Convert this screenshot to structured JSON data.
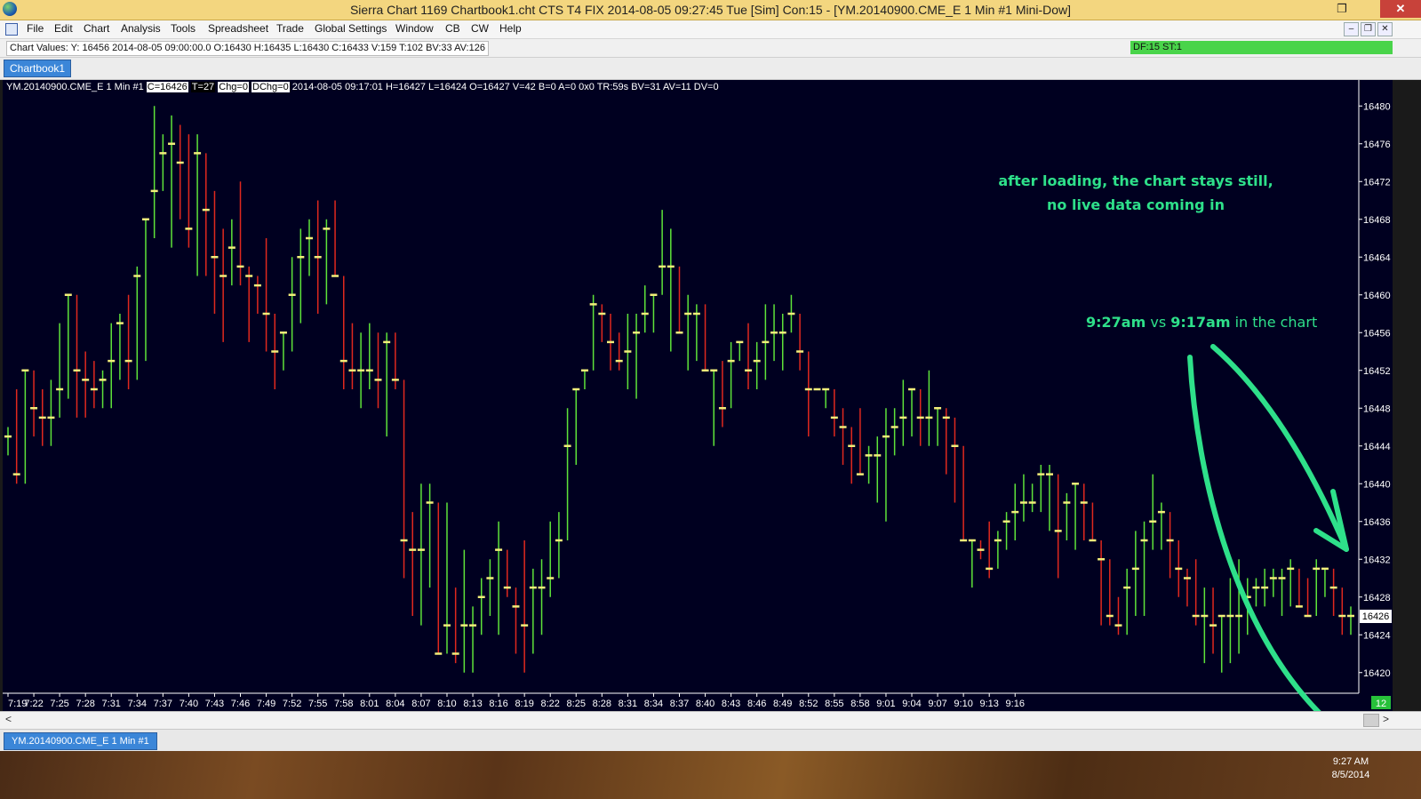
{
  "window": {
    "title": "Sierra Chart 1169 Chartbook1.cht  CTS T4 FIX 2014-08-05  09:27:45 Tue [Sim]  Con:15 - [YM.20140900.CME_E  1 Min   #1  Mini-Dow]",
    "restore_label": "❐",
    "close_label": "✕"
  },
  "menu": [
    "File",
    "Edit",
    "Chart",
    "Analysis",
    "Tools",
    "Spreadsheet",
    "Trade",
    "Global Settings",
    "Window",
    "CB",
    "CW",
    "Help"
  ],
  "mdi_buttons": [
    "–",
    "❐",
    "✕"
  ],
  "values_bar": {
    "chart_values": "Chart Values: Y: 16456  2014-08-05  09:00:00.0  O:16430  H:16435  L:16430  C:16433  V:159  T:102  BV:33  AV:126",
    "status": "DF:15  ST:1"
  },
  "chartbook_tab": "Chartbook1",
  "header": {
    "symbol": "YM.20140900.CME_E  1 Min   #1",
    "c": "C=16426",
    "t": "T=27",
    "chg": "Chg=0",
    "dchg": "DChg=0",
    "details": "2014-08-05 09:17:01 H=16427 L=16424 O=16427 V=42 B=0 A=0 0x0 TR:59s BV=31 AV=11 DV=0"
  },
  "price_axis": {
    "labels": [
      "16480",
      "16476",
      "16472",
      "16468",
      "16464",
      "16460",
      "16456",
      "16452",
      "16448",
      "16444",
      "16440",
      "16436",
      "16432",
      "16428",
      "16424",
      "16420"
    ],
    "current_price": "16426"
  },
  "time_axis": {
    "labels": [
      "7:19",
      "7:22",
      "7:25",
      "7:28",
      "7:31",
      "7:34",
      "7:37",
      "7:40",
      "7:43",
      "7:46",
      "7:49",
      "7:52",
      "7:55",
      "7:58",
      "8:01",
      "8:04",
      "8:07",
      "8:10",
      "8:13",
      "8:16",
      "8:19",
      "8:22",
      "8:25",
      "8:28",
      "8:31",
      "8:34",
      "8:37",
      "8:40",
      "8:43",
      "8:46",
      "8:49",
      "8:52",
      "8:55",
      "8:58",
      "9:01",
      "9:04",
      "9:07",
      "9:10",
      "9:13",
      "9:16"
    ],
    "corner_badge": "12"
  },
  "annotations": {
    "note1_line1": "after loading, the chart stays still,",
    "note1_line2": "no live data coming in",
    "note2_a": "9:27am",
    "note2_b": " vs ",
    "note2_c": "9:17am",
    "note2_d": " in the chart"
  },
  "bottom_tab": "YM.20140900.CME_E  1 Min   #1",
  "clock": {
    "time": "9:27 AM",
    "date": "8/5/2014"
  },
  "chart_data": {
    "type": "bar",
    "ohlc": [
      [
        16445,
        16446,
        16443,
        16445
      ],
      [
        16445,
        16450,
        16440,
        16441
      ],
      [
        16441,
        16452,
        16440,
        16452
      ],
      [
        16451,
        16452,
        16445,
        16448
      ],
      [
        16448,
        16450,
        16444,
        16447
      ],
      [
        16447,
        16451,
        16444,
        16447
      ],
      [
        16447,
        16457,
        16448,
        16450
      ],
      [
        16450,
        16460,
        16449,
        16460
      ],
      [
        16460,
        16460,
        16447,
        16452
      ],
      [
        16452,
        16454,
        16447,
        16451
      ],
      [
        16451,
        16453,
        16448,
        16450
      ],
      [
        16450,
        16452,
        16448,
        16451
      ],
      [
        16451,
        16457,
        16448,
        16453
      ],
      [
        16453,
        16458,
        16451,
        16457
      ],
      [
        16457,
        16460,
        16450,
        16453
      ],
      [
        16453,
        16463,
        16451,
        16462
      ],
      [
        16462,
        16468,
        16453,
        16468
      ],
      [
        16468,
        16480,
        16466,
        16471
      ],
      [
        16471,
        16477,
        16471,
        16475
      ],
      [
        16475,
        16479,
        16465,
        16476
      ],
      [
        16476,
        16478,
        16468,
        16474
      ],
      [
        16474,
        16477,
        16465,
        16467
      ],
      [
        16467,
        16477,
        16462,
        16475
      ],
      [
        16475,
        16475,
        16462,
        16469
      ],
      [
        16469,
        16471,
        16458,
        16464
      ],
      [
        16464,
        16467,
        16455,
        16462
      ],
      [
        16462,
        16468,
        16461,
        16465
      ],
      [
        16465,
        16472,
        16461,
        16463
      ],
      [
        16463,
        16462,
        16455,
        16462
      ],
      [
        16462,
        16462,
        16458,
        16461
      ],
      [
        16461,
        16466,
        16454,
        16458
      ],
      [
        16458,
        16456,
        16450,
        16454
      ],
      [
        16454,
        16456,
        16452,
        16456
      ],
      [
        16456,
        16464,
        16454,
        16460
      ],
      [
        16460,
        16467,
        16457,
        16464
      ],
      [
        16464,
        16468,
        16462,
        16466
      ],
      [
        16466,
        16470,
        16458,
        16464
      ],
      [
        16464,
        16468,
        16459,
        16467
      ],
      [
        16467,
        16470,
        16462,
        16462
      ],
      [
        16462,
        16458,
        16450,
        16453
      ],
      [
        16453,
        16457,
        16450,
        16452
      ],
      [
        16452,
        16456,
        16448,
        16452
      ],
      [
        16452,
        16457,
        16450,
        16452
      ],
      [
        16452,
        16456,
        16448,
        16451
      ],
      [
        16451,
        16456,
        16445,
        16455
      ],
      [
        16455,
        16456,
        16450,
        16451
      ],
      [
        16451,
        16450,
        16430,
        16434
      ],
      [
        16434,
        16437,
        16426,
        16433
      ],
      [
        16433,
        16440,
        16425,
        16433
      ],
      [
        16433,
        16440,
        16429,
        16438
      ],
      [
        16438,
        16437,
        16423,
        16422
      ],
      [
        16422,
        16438,
        16422,
        16425
      ],
      [
        16425,
        16429,
        16421,
        16422
      ],
      [
        16422,
        16433,
        16420,
        16425
      ],
      [
        16425,
        16427,
        16420,
        16425
      ],
      [
        16425,
        16430,
        16424,
        16428
      ],
      [
        16428,
        16432,
        16426,
        16430
      ],
      [
        16430,
        16436,
        16424,
        16433
      ],
      [
        16433,
        16432,
        16428,
        16429
      ],
      [
        16429,
        16428,
        16422,
        16427
      ],
      [
        16427,
        16434,
        16420,
        16425
      ],
      [
        16425,
        16431,
        16422,
        16429
      ],
      [
        16429,
        16432,
        16424,
        16429
      ],
      [
        16429,
        16436,
        16428,
        16430
      ],
      [
        16430,
        16437,
        16432,
        16434
      ],
      [
        16434,
        16448,
        16435,
        16444
      ],
      [
        16444,
        16448,
        16442,
        16450
      ],
      [
        16450,
        16452,
        16450,
        16452
      ],
      [
        16452,
        16460,
        16454,
        16459
      ],
      [
        16459,
        16459,
        16455,
        16458
      ],
      [
        16458,
        16458,
        16452,
        16455
      ],
      [
        16455,
        16456,
        16452,
        16453
      ],
      [
        16453,
        16458,
        16450,
        16454
      ],
      [
        16454,
        16458,
        16449,
        16456
      ],
      [
        16456,
        16461,
        16456,
        16458
      ],
      [
        16458,
        16460,
        16456,
        16460
      ],
      [
        16460,
        16469,
        16460,
        16463
      ],
      [
        16463,
        16467,
        16454,
        16463
      ],
      [
        16463,
        16463,
        16456,
        16456
      ],
      [
        16456,
        16460,
        16452,
        16458
      ],
      [
        16458,
        16459,
        16453,
        16458
      ],
      [
        16458,
        16459,
        16453,
        16452
      ],
      [
        16452,
        16451,
        16444,
        16452
      ],
      [
        16452,
        16453,
        16446,
        16448
      ],
      [
        16448,
        16455,
        16449,
        16453
      ],
      [
        16453,
        16455,
        16453,
        16455
      ],
      [
        16455,
        16457,
        16450,
        16452
      ],
      [
        16452,
        16455,
        16450,
        16453
      ],
      [
        16453,
        16459,
        16451,
        16455
      ],
      [
        16455,
        16459,
        16453,
        16456
      ],
      [
        16456,
        16458,
        16452,
        16456
      ],
      [
        16456,
        16460,
        16456,
        16458
      ],
      [
        16458,
        16457,
        16452,
        16454
      ],
      [
        16454,
        16454,
        16445,
        16450
      ],
      [
        16450,
        16450,
        16450,
        16450
      ],
      [
        16450,
        16450,
        16448,
        16450
      ],
      [
        16450,
        16449,
        16445,
        16447
      ],
      [
        16447,
        16448,
        16442,
        16446
      ],
      [
        16446,
        16445,
        16440,
        16444
      ],
      [
        16444,
        16448,
        16441,
        16441
      ],
      [
        16441,
        16444,
        16440,
        16443
      ],
      [
        16443,
        16445,
        16438,
        16443
      ],
      [
        16443,
        16448,
        16436,
        16445
      ],
      [
        16445,
        16448,
        16443,
        16446
      ],
      [
        16446,
        16451,
        16444,
        16447
      ],
      [
        16447,
        16449,
        16445,
        16450
      ],
      [
        16450,
        16449,
        16444,
        16447
      ],
      [
        16447,
        16452,
        16444,
        16447
      ],
      [
        16447,
        16446,
        16444,
        16448
      ],
      [
        16448,
        16446,
        16441,
        16447
      ],
      [
        16447,
        16443,
        16438,
        16444
      ],
      [
        16444,
        16444,
        16436,
        16434
      ],
      [
        16434,
        16432,
        16429,
        16434
      ],
      [
        16434,
        16432,
        16432,
        16433
      ],
      [
        16433,
        16436,
        16430,
        16431
      ],
      [
        16431,
        16435,
        16431,
        16434
      ],
      [
        16434,
        16437,
        16433,
        16436
      ],
      [
        16436,
        16440,
        16434,
        16437
      ],
      [
        16437,
        16441,
        16436,
        16438
      ],
      [
        16438,
        16440,
        16437,
        16438
      ],
      [
        16438,
        16442,
        16437,
        16441
      ],
      [
        16441,
        16442,
        16435,
        16441
      ],
      [
        16441,
        16435,
        16430,
        16435
      ],
      [
        16435,
        16439,
        16434,
        16438
      ],
      [
        16438,
        16440,
        16433,
        16440
      ],
      [
        16440,
        16440,
        16434,
        16438
      ],
      [
        16438,
        16437,
        16434,
        16434
      ],
      [
        16434,
        16430,
        16425,
        16432
      ],
      [
        16432,
        16430,
        16425,
        16426
      ],
      [
        16426,
        16428,
        16424,
        16425
      ],
      [
        16425,
        16431,
        16424,
        16429
      ],
      [
        16429,
        16435,
        16426,
        16431
      ],
      [
        16431,
        16436,
        16426,
        16434
      ],
      [
        16434,
        16441,
        16433,
        16436
      ],
      [
        16436,
        16438,
        16433,
        16437
      ],
      [
        16437,
        16435,
        16430,
        16434
      ],
      [
        16434,
        16433,
        16428,
        16431
      ],
      [
        16431,
        16431,
        16427,
        16430
      ],
      [
        16430,
        16432,
        16425,
        16426
      ],
      [
        16426,
        16429,
        16421,
        16426
      ],
      [
        16426,
        16429,
        16422,
        16425
      ],
      [
        16425,
        16426,
        16420,
        16426
      ],
      [
        16426,
        16430,
        16421,
        16426
      ],
      [
        16426,
        16432,
        16422,
        16426
      ],
      [
        16426,
        16430,
        16424,
        16428
      ],
      [
        16428,
        16430,
        16427,
        16429
      ],
      [
        16429,
        16431,
        16427,
        16429
      ],
      [
        16429,
        16431,
        16428,
        16430
      ],
      [
        16430,
        16431,
        16426,
        16430
      ],
      [
        16430,
        16432,
        16427,
        16431
      ],
      [
        16431,
        16431,
        16427,
        16427
      ],
      [
        16427,
        16430,
        16426,
        16426
      ],
      [
        16426,
        16432,
        16426,
        16431
      ],
      [
        16431,
        16431,
        16428,
        16431
      ],
      [
        16431,
        16430,
        16426,
        16429
      ],
      [
        16429,
        16428,
        16424,
        16426
      ],
      [
        16426,
        16427,
        16424,
        16426
      ]
    ],
    "ylim": [
      16418,
      16482
    ]
  }
}
